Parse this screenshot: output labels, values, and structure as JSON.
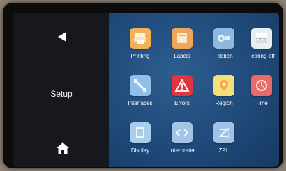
{
  "sidebar": {
    "title": "Setup",
    "back_icon": "back-arrow-icon",
    "home_icon": "home-icon"
  },
  "menu": {
    "items": [
      {
        "label": "Printing",
        "icon": "printing-icon",
        "color": "#f0b35a"
      },
      {
        "label": "Labels",
        "icon": "labels-icon",
        "color": "#f0a65a"
      },
      {
        "label": "Ribbon",
        "icon": "ribbon-icon",
        "color": "#8fb8de"
      },
      {
        "label": "Tearing-off",
        "icon": "tear-off-icon",
        "color": "#e9eef2"
      },
      {
        "label": "Interfaces",
        "icon": "interfaces-icon",
        "color": "#8fc0e8"
      },
      {
        "label": "Errors",
        "icon": "errors-icon",
        "color": "#e0353f"
      },
      {
        "label": "Region",
        "icon": "region-icon",
        "color": "#f2e07a"
      },
      {
        "label": "Time",
        "icon": "time-icon",
        "color": "#e86b6b"
      },
      {
        "label": "Display",
        "icon": "display-icon",
        "color": "#a9cdea"
      },
      {
        "label": "Interpreter",
        "icon": "interpreter-icon",
        "color": "#a3c4e4"
      },
      {
        "label": "ZPL",
        "icon": "zpl-icon",
        "color": "#9fc2e6"
      }
    ]
  },
  "colors": {
    "panel_background": "#1f4a7a",
    "sidebar_background": "#16181e",
    "text": "#ffffff"
  }
}
